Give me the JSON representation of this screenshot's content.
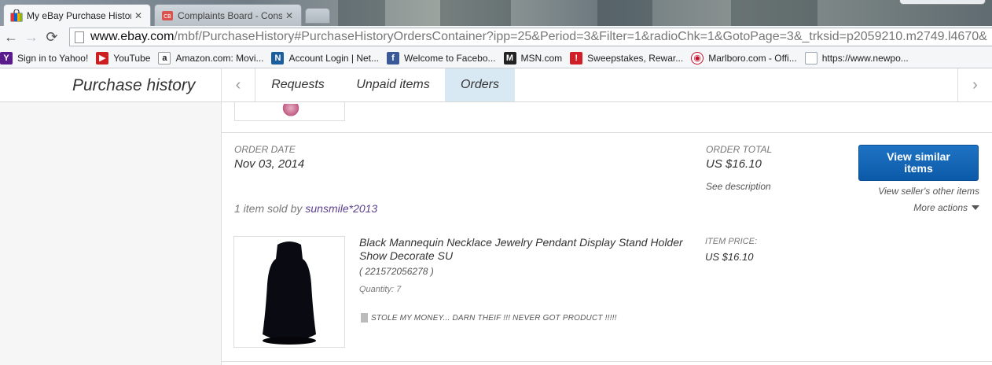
{
  "browser": {
    "tabs": [
      {
        "title": "My eBay Purchase History",
        "active": true
      },
      {
        "title": "Complaints Board - Consu",
        "active": false
      }
    ],
    "url": {
      "host": "www.ebay.com",
      "path": "/mbf/PurchaseHistory#PurchaseHistoryOrdersContainer?ipp=25&Period=3&Filter=1&radioChk=1&GotoPage=3&_trksid=p2059210.m2749.l4670&"
    },
    "bookmarks": [
      {
        "label": "Sign in to Yahoo!",
        "icon": "yahoo-icon",
        "color": "#5a1c8c"
      },
      {
        "label": "YouTube",
        "icon": "youtube-icon",
        "color": "#cc1f1f"
      },
      {
        "label": "Amazon.com: Movi...",
        "icon": "amazon-icon",
        "color": "#222222"
      },
      {
        "label": "Account Login | Net...",
        "icon": "netzero-icon",
        "color": "#1b5e9c"
      },
      {
        "label": "Welcome to Facebo...",
        "icon": "facebook-icon",
        "color": "#3b5998"
      },
      {
        "label": "MSN.com",
        "icon": "msn-icon",
        "color": "#222222"
      },
      {
        "label": "Sweepstakes, Rewar...",
        "icon": "sweepstakes-icon",
        "color": "#d11f2a"
      },
      {
        "label": "Marlboro.com - Offi...",
        "icon": "marlboro-icon",
        "color": "#c8102e"
      },
      {
        "label": "https://www.newpo...",
        "icon": "page-icon",
        "color": "#9aa7b3"
      }
    ]
  },
  "subnav": {
    "title": "Purchase history",
    "tabs": {
      "requests": "Requests",
      "unpaid": "Unpaid items",
      "orders": "Orders"
    },
    "active_tab": "Orders"
  },
  "order": {
    "date_label": "ORDER DATE",
    "date": "Nov 03, 2014",
    "total_label": "ORDER TOTAL",
    "total": "US $16.10",
    "see_description": "See description",
    "view_similar": "View similar items",
    "seller_other": "View seller's other items",
    "more_actions": "More actions",
    "sold_by_prefix": "1 item sold by",
    "seller": "sunsmile*2013",
    "item": {
      "title": "Black Mannequin Necklace Jewelry Pendant Display Stand Holder Show Decorate SU",
      "id": "( 221572056278 )",
      "quantity": "Quantity: 7",
      "price_label": "ITEM PRICE:",
      "price": "US $16.10",
      "note": "STOLE MY MONEY... DARN THEIF !!! NEVER GOT PRODUCT !!!!!"
    }
  },
  "colors": {
    "accent_blue": "#0b5aa9",
    "active_tab_bg": "#d9e9f4",
    "seller_link": "#5a3f8f"
  }
}
